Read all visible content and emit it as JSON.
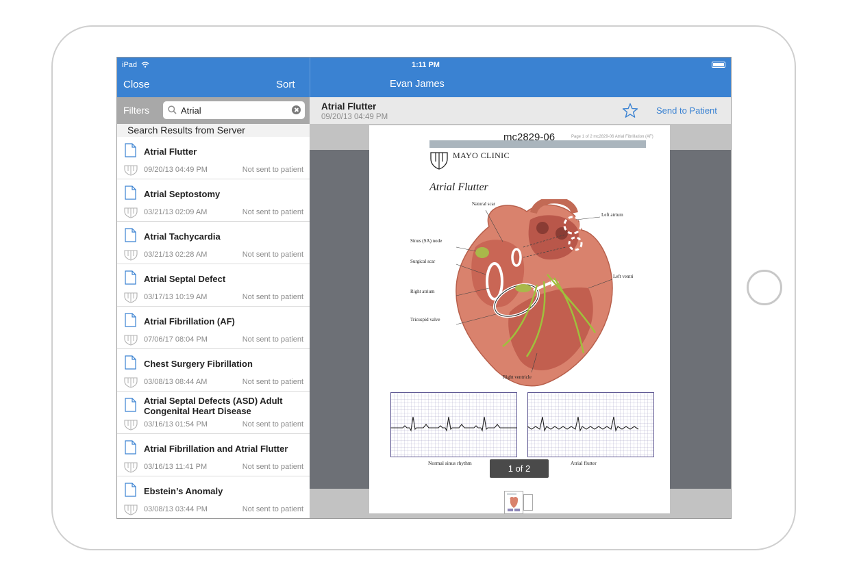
{
  "status_bar": {
    "carrier": "iPad",
    "time": "1:11 PM"
  },
  "nav": {
    "close_label": "Close",
    "sort_label": "Sort",
    "patient_name": "Evan James"
  },
  "search": {
    "filters_label": "Filters",
    "query": "Atrial"
  },
  "results": {
    "header": "Search Results from Server",
    "items": [
      {
        "title": "Atrial Flutter",
        "date": "09/20/13 04:49 PM",
        "status": "Not sent to patient"
      },
      {
        "title": "Atrial Septostomy",
        "date": "03/21/13 02:09 AM",
        "status": "Not sent to patient"
      },
      {
        "title": "Atrial Tachycardia",
        "date": "03/21/13 02:28 AM",
        "status": "Not sent to patient"
      },
      {
        "title": "Atrial Septal Defect",
        "date": "03/17/13 10:19 AM",
        "status": "Not sent to patient"
      },
      {
        "title": "Atrial Fibrillation (AF)",
        "date": "07/06/17 08:04 PM",
        "status": "Not sent to patient"
      },
      {
        "title": "Chest Surgery Fibrillation",
        "date": "03/08/13 08:44 AM",
        "status": "Not sent to patient"
      },
      {
        "title": "Atrial Septal Defects (ASD) Adult Congenital Heart Disease",
        "date": "03/16/13 01:54 PM",
        "status": "Not sent to patient"
      },
      {
        "title": "Atrial Fibrillation and Atrial Flutter",
        "date": "03/16/13 11:41 PM",
        "status": "Not sent to patient"
      },
      {
        "title": "Ebstein’s Anomaly",
        "date": "03/08/13 03:44 PM",
        "status": "Not sent to patient"
      }
    ]
  },
  "document": {
    "title": "Atrial Flutter",
    "date": "09/20/13 04:49 PM",
    "send_label": "Send to Patient",
    "doc_id": "mc2829-06",
    "page_header": "Page 1 of 2   mc2829-06  Atrial Fibrillation (AF)",
    "clinic_name": "MAYO CLINIC",
    "page_title": "Atrial Flutter",
    "labels": {
      "natural_scar": "Natural scar",
      "left_atrium": "Left atrium",
      "sinus_node": "Sinus (SA) node",
      "surgical_scar": "Surgical scar",
      "right_atrium": "Right atrium",
      "left_ventricle": "Left ventricle",
      "tricuspid_valve": "Tricuspid valve",
      "right_ventricle": "Right ventricle"
    },
    "ekg_normal_label": "Normal sinus rhythm",
    "ekg_flutter_label": "Atrial flutter",
    "page_counter": "1 of 2"
  },
  "colors": {
    "accent": "#3a82d2",
    "heart": "#d9826d",
    "conduction": "#9fc03c"
  }
}
